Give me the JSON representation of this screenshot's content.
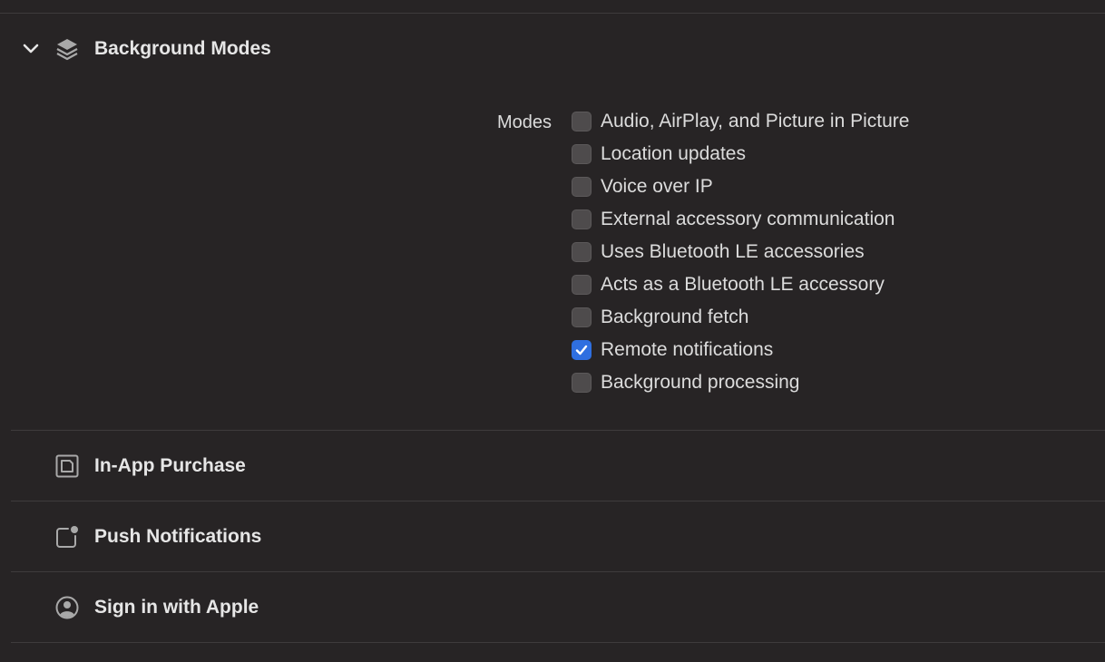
{
  "background_modes": {
    "title": "Background Modes",
    "expanded": true,
    "modes_label": "Modes",
    "modes": [
      {
        "label": "Audio, AirPlay, and Picture in Picture",
        "checked": false
      },
      {
        "label": "Location updates",
        "checked": false
      },
      {
        "label": "Voice over IP",
        "checked": false
      },
      {
        "label": "External accessory communication",
        "checked": false
      },
      {
        "label": "Uses Bluetooth LE accessories",
        "checked": false
      },
      {
        "label": "Acts as a Bluetooth LE accessory",
        "checked": false
      },
      {
        "label": "Background fetch",
        "checked": false
      },
      {
        "label": "Remote notifications",
        "checked": true
      },
      {
        "label": "Background processing",
        "checked": false
      }
    ]
  },
  "in_app_purchase": {
    "title": "In-App Purchase"
  },
  "push_notifications": {
    "title": "Push Notifications"
  },
  "sign_in_with_apple": {
    "title": "Sign in with Apple"
  },
  "colors": {
    "background": "#272425",
    "divider": "#3e3b3c",
    "checkbox": "#4e4b4c",
    "accent": "#2f6fe0"
  }
}
